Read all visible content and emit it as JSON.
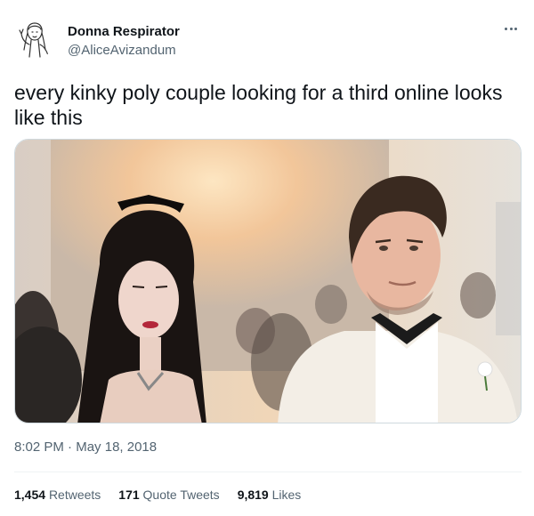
{
  "author": {
    "display_name": "Donna Respirator",
    "handle": "@AliceAvizandum"
  },
  "tweet": {
    "text": "every kinky poly couple looking for a third online looks like this",
    "time": "8:02 PM",
    "separator": "·",
    "date": "May 18, 2018"
  },
  "stats": {
    "retweets": {
      "count": "1,454",
      "label": "Retweets"
    },
    "quote_tweets": {
      "count": "171",
      "label": "Quote Tweets"
    },
    "likes": {
      "count": "9,819",
      "label": "Likes"
    }
  },
  "icons": {
    "more": "more-options-icon",
    "avatar": "line-drawing-avatar"
  },
  "colors": {
    "text_primary": "#0f1419",
    "text_secondary": "#536471",
    "border": "#cfd9de",
    "divider": "#eff3f4"
  }
}
